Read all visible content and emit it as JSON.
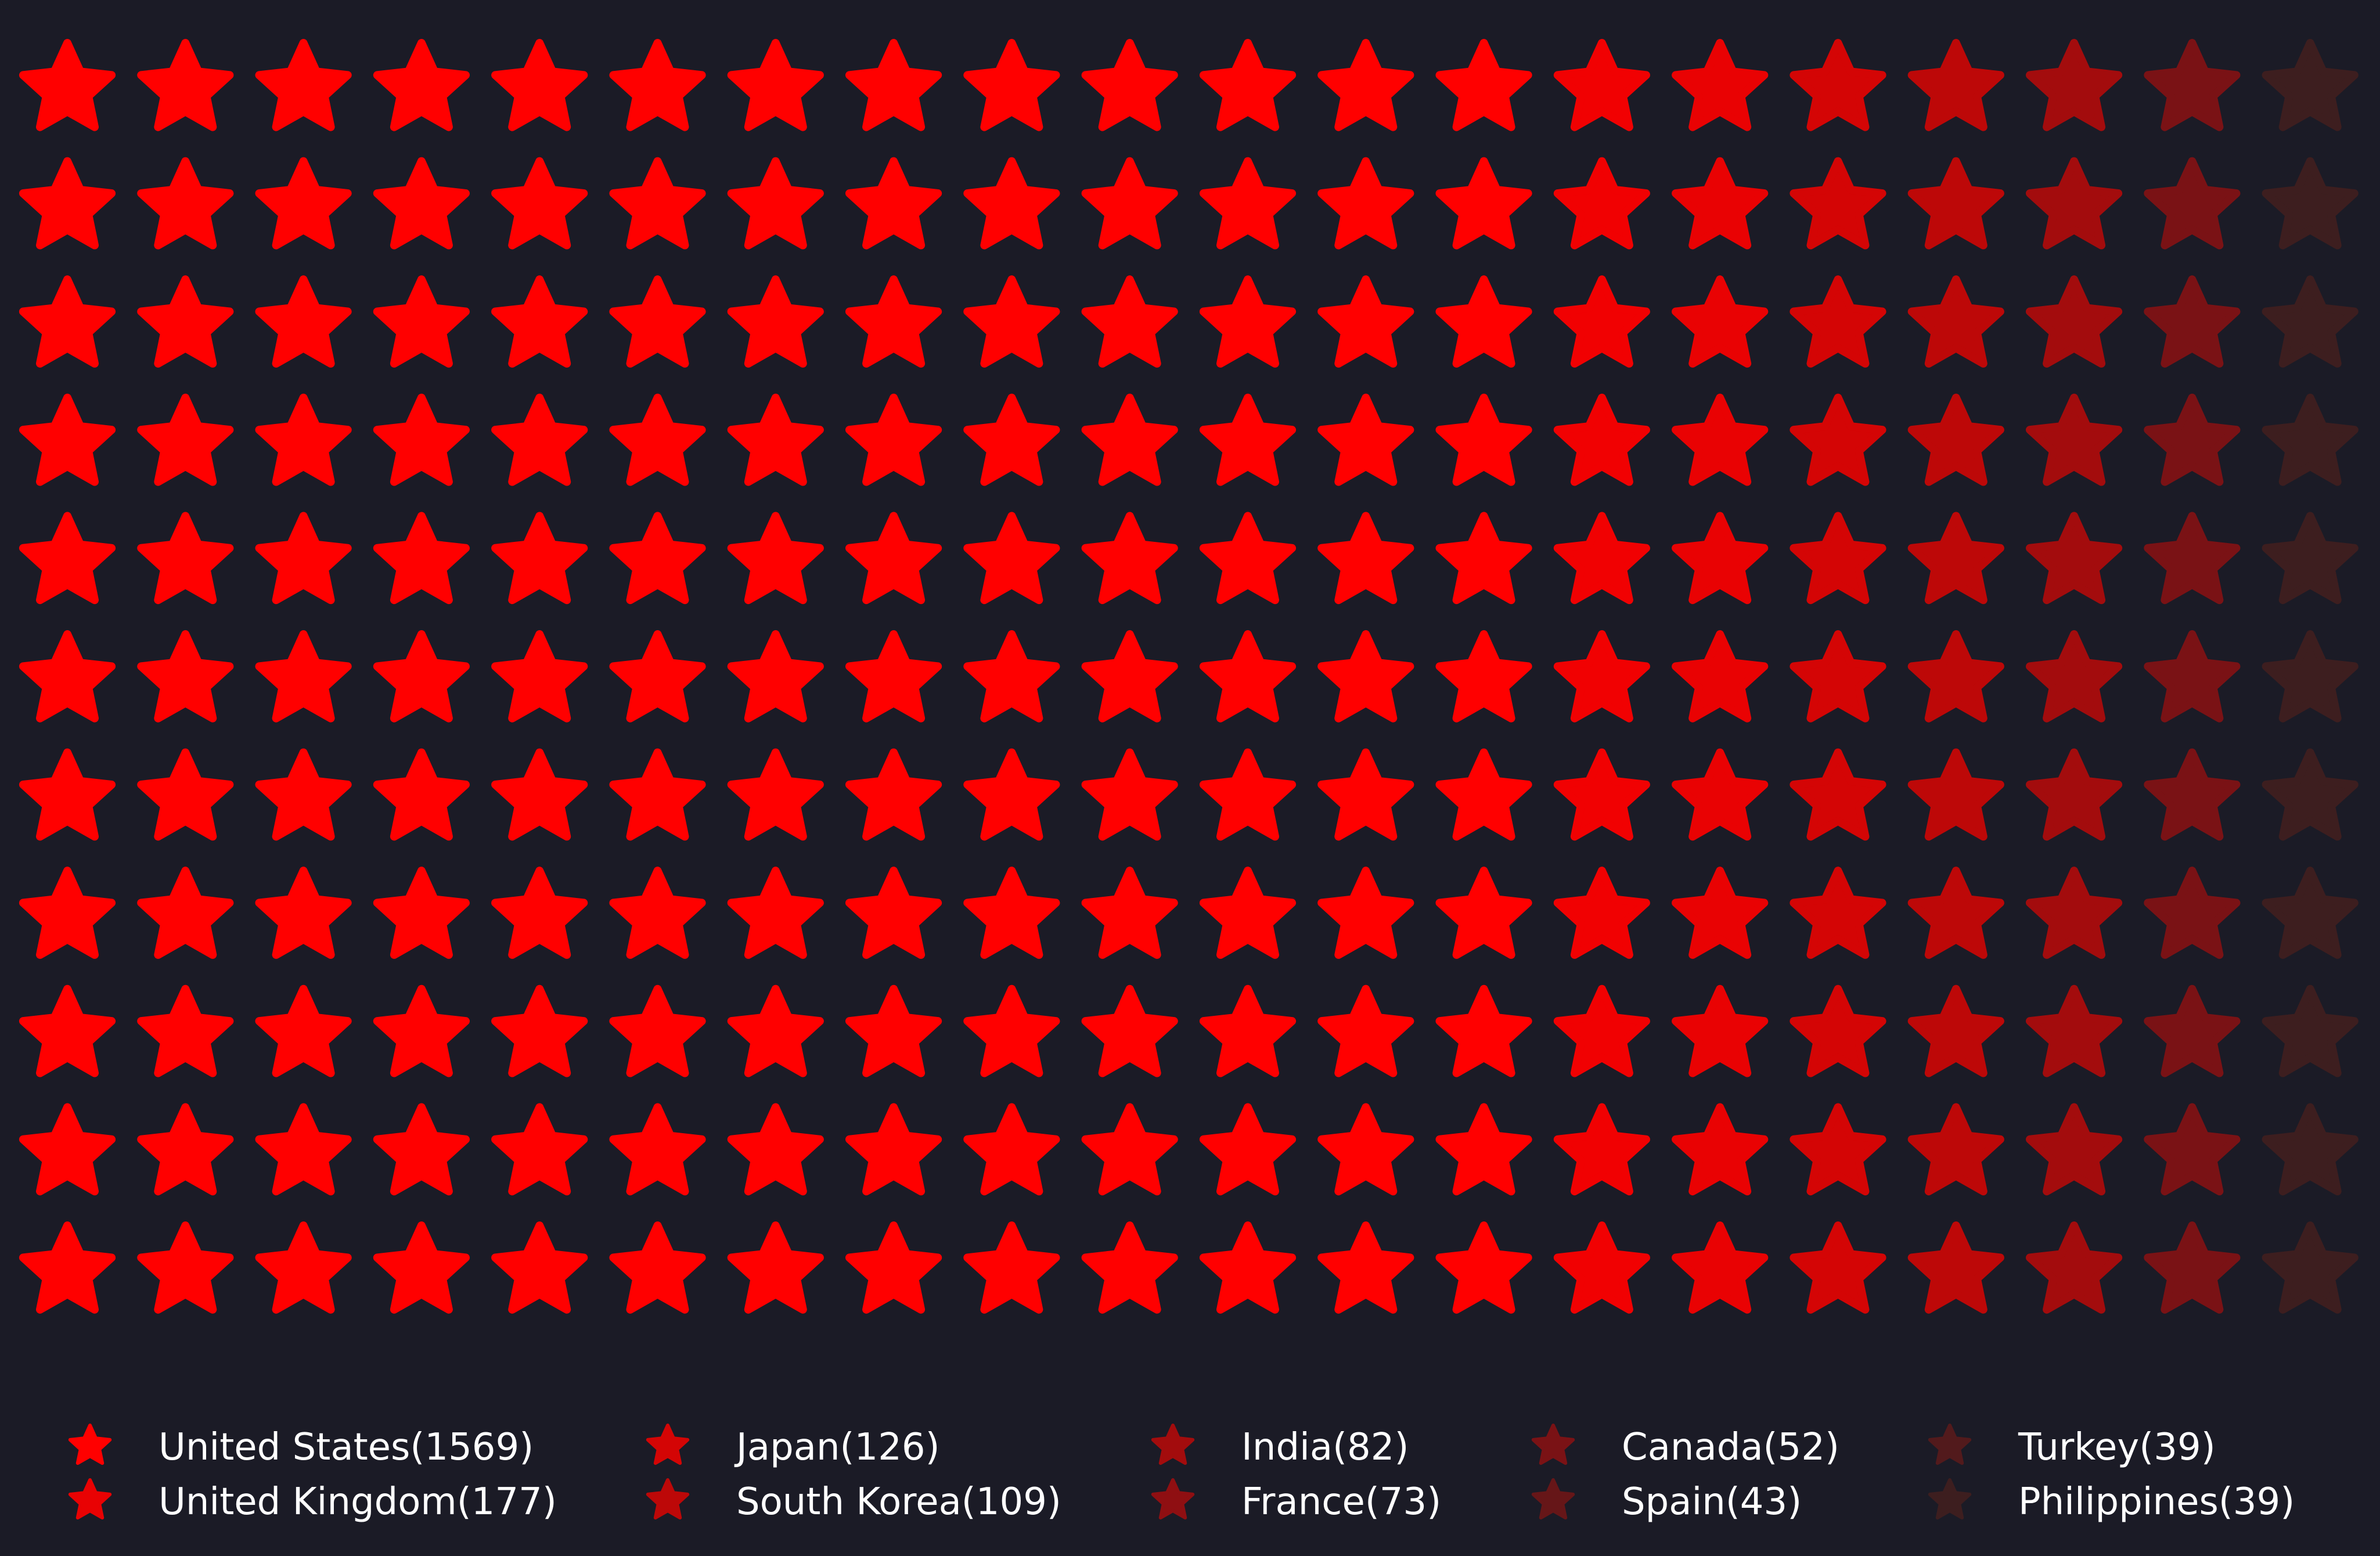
{
  "chart_data": {
    "type": "pictogram",
    "grid": {
      "rows": 11,
      "columns": 20
    },
    "marker": "star-icon",
    "background": "#1b1b26",
    "legend_position": "bottom",
    "series": [
      {
        "name": "United States",
        "value": 1569,
        "label": "United States(1569)",
        "color": "#ff0000"
      },
      {
        "name": "United Kingdom",
        "value": 177,
        "label": "United Kingdom(177)",
        "color": "#e90203"
      },
      {
        "name": "Japan",
        "value": 126,
        "label": "Japan(126)",
        "color": "#d40505"
      },
      {
        "name": "South Korea",
        "value": 109,
        "label": "South Korea(109)",
        "color": "#bd0808"
      },
      {
        "name": "India",
        "value": 82,
        "label": "India(82)",
        "color": "#a30c0d"
      },
      {
        "name": "France",
        "value": 73,
        "label": "France(73)",
        "color": "#8f0f12"
      },
      {
        "name": "Canada",
        "value": 52,
        "label": "Canada(52)",
        "color": "#7a1215"
      },
      {
        "name": "Spain",
        "value": 43,
        "label": "Spain(43)",
        "color": "#661618"
      },
      {
        "name": "Turkey",
        "value": 39,
        "label": "Turkey(39)",
        "color": "#521a1c"
      },
      {
        "name": "Philippines",
        "value": 39,
        "label": "Philippines(39)",
        "color": "#3d1e1f"
      }
    ],
    "column_colors": [
      "#ff0000",
      "#ff0000",
      "#ff0000",
      "#ff0000",
      "#ff0000",
      "#ff0000",
      "#ff0000",
      "#ff0000",
      "#ff0000",
      "#ff0000",
      "#ff0000",
      "#ff0000",
      "#ff0000",
      "#f10102",
      "#e90203",
      "#d40505",
      "#bd0808",
      "#a30c0d",
      "#7a1215",
      "#3d1e1f"
    ]
  }
}
